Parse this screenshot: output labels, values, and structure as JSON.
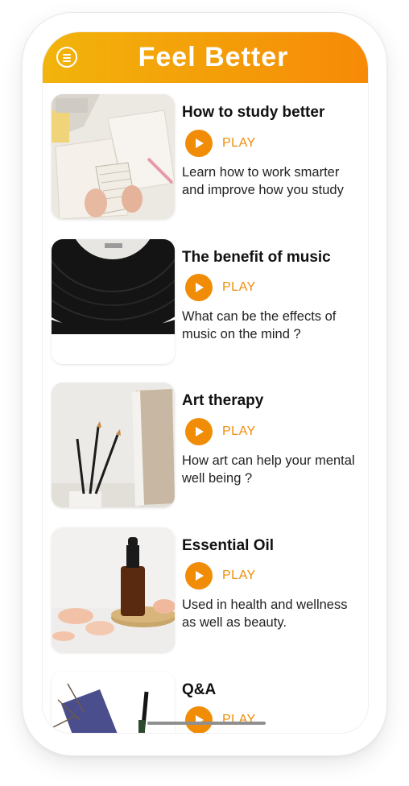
{
  "header": {
    "title": "Feel Better",
    "menu_icon": "hamburger-menu-icon"
  },
  "accent_color": "#f08c06",
  "header_gradient": [
    "#f2b40c",
    "#f78a07"
  ],
  "items": [
    {
      "title": "How to study better",
      "play_label": "PLAY",
      "description": "Learn how to work smarter and improve how you study",
      "image": "notebook-study-image"
    },
    {
      "title": "The benefit of music",
      "play_label": "PLAY",
      "description": "What can be the effects of music on the mind ?",
      "image": "vinyl-record-image"
    },
    {
      "title": "Art therapy",
      "play_label": "PLAY",
      "description": "How art can help your mental well being ?",
      "image": "paintbrushes-canvas-image"
    },
    {
      "title": "Essential Oil",
      "play_label": "PLAY",
      "description": "Used in health and wellness as well as beauty.",
      "image": "essential-oil-bottle-image"
    },
    {
      "title": "Q&A",
      "play_label": "PLAY",
      "image": "notebook-pen-image"
    }
  ]
}
